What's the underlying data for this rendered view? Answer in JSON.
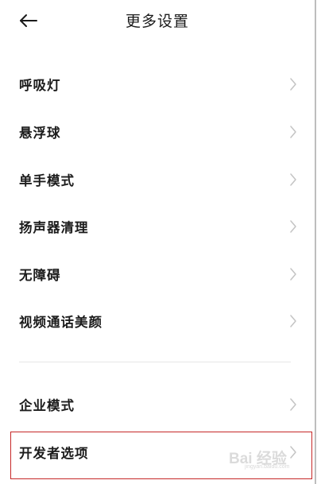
{
  "header": {
    "title": "更多设置",
    "back_icon": "arrow-left-icon"
  },
  "settings": {
    "items": [
      {
        "label": "呼吸灯"
      },
      {
        "label": "悬浮球"
      },
      {
        "label": "单手模式"
      },
      {
        "label": "扬声器清理"
      },
      {
        "label": "无障碍"
      },
      {
        "label": "视频通话美颜"
      },
      {
        "label": "企业模式"
      },
      {
        "label": "开发者选项"
      }
    ],
    "chevron_icon": "chevron-right-icon"
  },
  "annotation": {
    "highlight_color": "#c62828"
  },
  "watermark": {
    "text": "Bai 经验",
    "sub": "jingyan.baidu.com"
  }
}
